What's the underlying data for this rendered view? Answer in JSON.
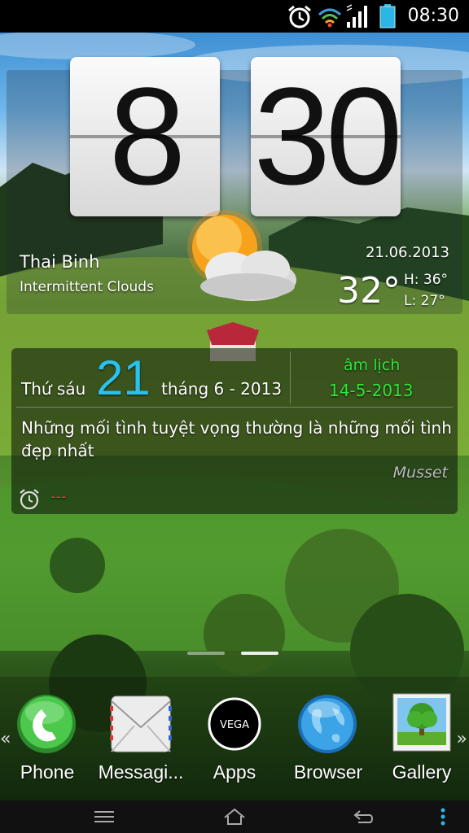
{
  "status_bar": {
    "time": "08:30",
    "icons": [
      "alarm-icon",
      "wifi-icon",
      "signal-icon",
      "battery-icon"
    ]
  },
  "clock": {
    "hour": "8",
    "minute": "30"
  },
  "weather": {
    "location": "Thai Binh",
    "condition": "Intermittent Clouds",
    "date": "21.06.2013",
    "temperature": "32°",
    "high": "H:  36°",
    "low": "L:  27°"
  },
  "calendar": {
    "weekday": "Thứ sáu",
    "day": "21",
    "month_year": "tháng 6 - 2013",
    "lunar_label": "âm lịch",
    "lunar_date": "14-5-2013",
    "quote": "Những mối tình tuyệt vọng thường là những mối tình đẹp nhất",
    "author": "Musset",
    "alarm_text": "---"
  },
  "dock": [
    {
      "label": "Phone",
      "icon": "phone-icon"
    },
    {
      "label": "Messagi...",
      "icon": "messaging-icon"
    },
    {
      "label": "Apps",
      "icon": "apps-icon"
    },
    {
      "label": "Browser",
      "icon": "browser-icon"
    },
    {
      "label": "Gallery",
      "icon": "gallery-icon"
    }
  ],
  "colors": {
    "day_accent": "#29c2ee",
    "lunar_accent": "#2ee63a",
    "alarm_red": "#e23b3b"
  }
}
